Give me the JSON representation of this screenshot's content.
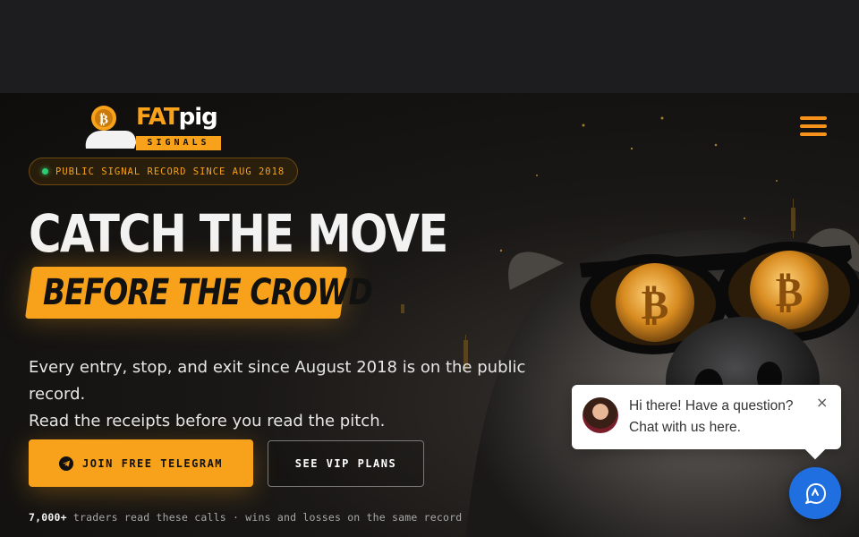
{
  "brand": {
    "fat": "FAT",
    "pig": "pig",
    "sub": "SIGNALS"
  },
  "hero": {
    "badge": "PUBLIC SIGNAL RECORD SINCE AUG 2018",
    "headline": "CATCH THE MOVE",
    "subheadline": "BEFORE THE CROWD",
    "body_line1": "Every entry, stop, and exit since August 2018 is on the public record.",
    "body_line2": "Read the receipts before you read the pitch.",
    "cta_primary": "JOIN FREE TELEGRAM",
    "cta_secondary": "SEE VIP PLANS",
    "proof_count": "7,000+",
    "proof_text": " traders read these calls · wins and losses on the same record"
  },
  "chat": {
    "line1": "Hi there! Have a question?",
    "line2": "Chat with us here.",
    "close": "×"
  },
  "icons": {
    "menu": "hamburger-icon",
    "telegram": "telegram-icon",
    "chat": "chat-bubble-icon",
    "bitcoin": "bitcoin-icon"
  },
  "colors": {
    "accent": "#f7a21a",
    "background": "#1c1c1e",
    "chat_launcher": "#1f6fe0",
    "status_dot": "#2ecc71"
  }
}
